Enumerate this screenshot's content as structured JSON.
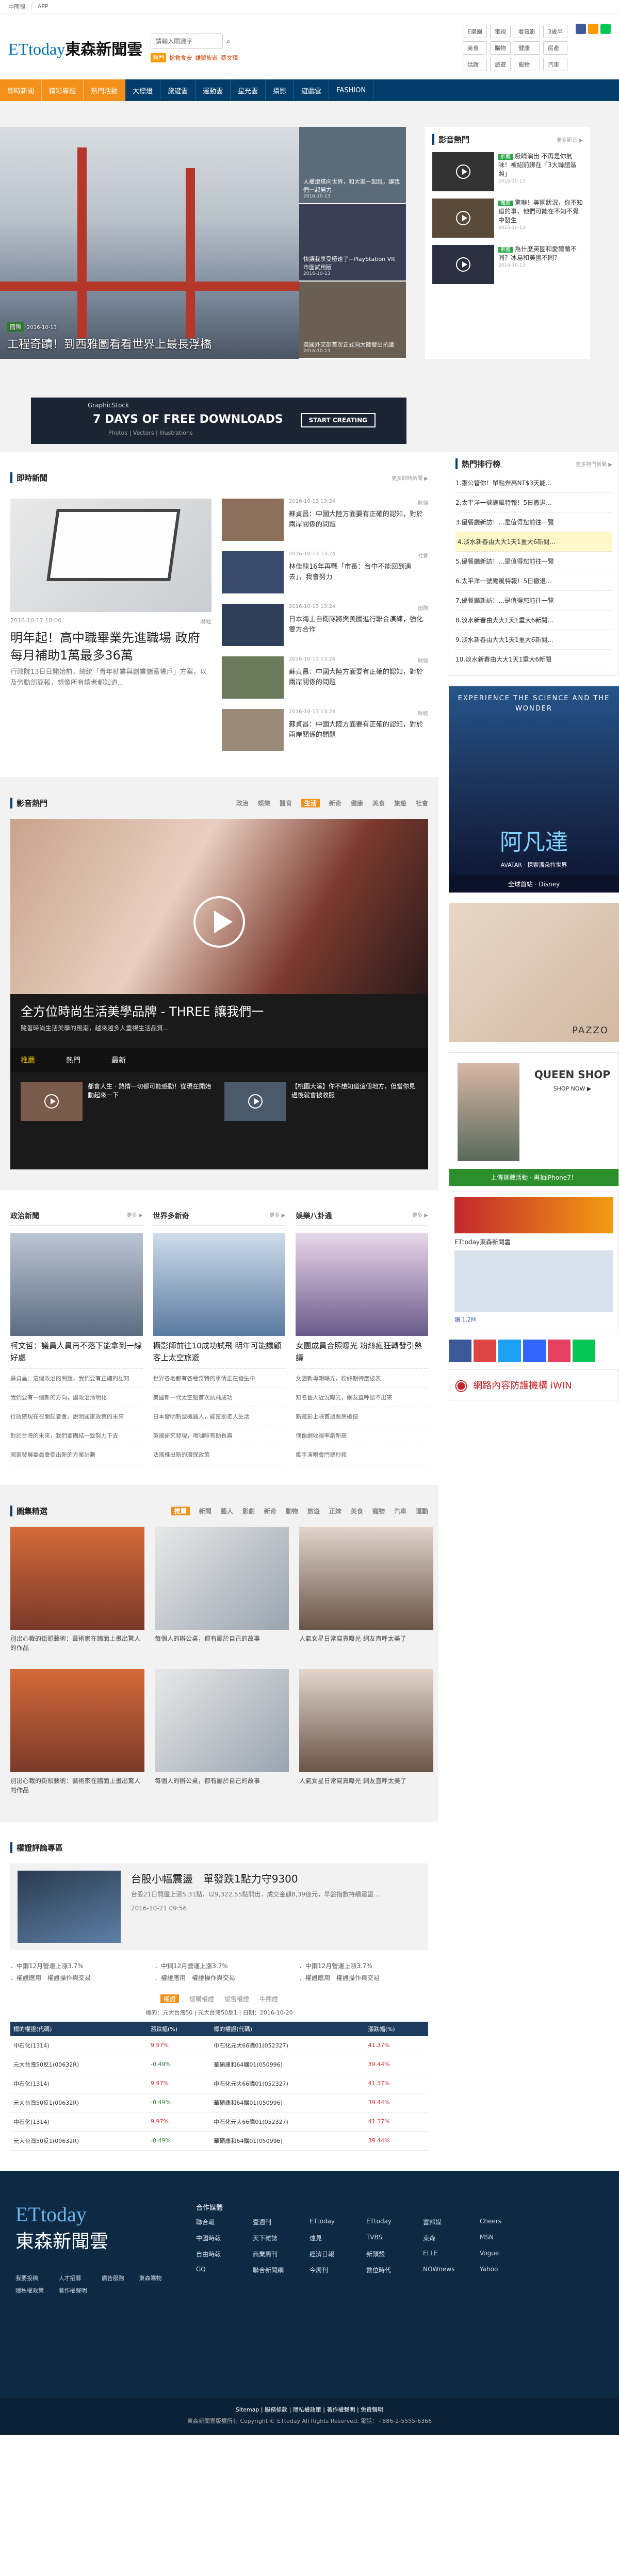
{
  "topbar": {
    "links": [
      "中國報",
      "APP"
    ]
  },
  "header": {
    "logo_en": "ETtoday",
    "logo_zh": "東森新聞雲",
    "search_placeholder": "請輸入關鍵字",
    "hot_label": "熱門",
    "hot_terms": [
      "搶救食安",
      "雄獅旅遊",
      "蔡文輝"
    ],
    "links": [
      "E樂園",
      "電視",
      "看電影",
      "3歲半",
      "美食",
      "購物",
      "健康",
      "房產",
      "話題",
      "旅遊",
      "寵物",
      "汽車"
    ]
  },
  "nav": {
    "orange": [
      "即時新聞",
      "精彩專題",
      "熱門活動"
    ],
    "items": [
      "大標燈",
      "旅遊雲",
      "運動雲",
      "星光雲",
      "攝影",
      "遊戲雲",
      "FASHION"
    ]
  },
  "hero": {
    "tag": "國際",
    "date": "2016-10-13",
    "title": "工程奇蹟！到西雅圖看看世界上最長浮橋",
    "side": [
      {
        "title": "人權燈塔向世界，和大家一起說，讓我們一起努力",
        "date": "2016-10-13"
      },
      {
        "title": "快讓我享受極速了~PlayStation VR 市面試用版",
        "date": "2016-10-13"
      },
      {
        "title": "英國外交部首次正式向大陸發出抗議",
        "date": "2016-10-13"
      }
    ]
  },
  "hot_video": {
    "title": "影音熱門",
    "more": "更多影音 ▶",
    "items": [
      {
        "tag": "推薦",
        "title": "吸睛演出 不再是你氣味！被紹前綁在「3大聯誼區照」",
        "date": "2016-10-13"
      },
      {
        "tag": "推薦",
        "title": "驚嚇！美國狀況，你不知道的事，他們可能在不知不覺中發生",
        "date": "2016-10-13"
      },
      {
        "tag": "推薦",
        "title": "為什麼英國和愛爾蘭不同？冰島和美國不同？",
        "date": "2016-10-13"
      }
    ]
  },
  "ad_banner": {
    "brand": "GraphicStock",
    "headline": "7 DAYS OF FREE DOWNLOADS",
    "sub": "Photos | Vectors | Illustrations",
    "cta": "START CREATING"
  },
  "instant": {
    "title": "即時新聞",
    "more": "更多即時新聞 ▶",
    "lead": {
      "date": "2016-10-17 18:00",
      "tag": "財經",
      "title": "明年起！高中職畢業先進職場 政府每月補助1萬最多36萬",
      "excerpt": "行政院13日日開始前，總統「青年就業與創業儲蓄帳戶」方案，以及勞動部簡報，想像所有讀者都知道..."
    },
    "items": [
      {
        "date": "2016-10-13 13:24",
        "tag": "財經",
        "title": "蘇貞昌：中國大陸方面要有正確的認知，對於兩岸關係的問題"
      },
      {
        "date": "2016-10-13 13:24",
        "tag": "社會",
        "title": "林佳龍16年再戰「市長：台中不能回到過去」，我會努力"
      },
      {
        "date": "2016-10-13 13:24",
        "tag": "國際",
        "title": "日本海上自衛隊將與美國進行聯合演練，強化雙方合作"
      },
      {
        "date": "2016-10-13 13:24",
        "tag": "財經",
        "title": "蘇貞昌：中國大陸方面要有正確的認知，對於兩岸關係的問題"
      },
      {
        "date": "2016-10-13 13:24",
        "tag": "財經",
        "title": "蘇貞昌：中國大陸方面要有正確的認知，對於兩岸關係的問題"
      }
    ]
  },
  "video_sec": {
    "title": "影音熱門",
    "tabs": [
      "政治",
      "娛樂",
      "體育",
      "生活",
      "新奇",
      "健康",
      "美食",
      "旅遊",
      "社會"
    ],
    "active_tab": "生活",
    "main_title": "全方位時尚生活美學品牌 - THREE 讓我們一",
    "main_sub": "隨著時尚生活美學的風潮，越來越多人重視生活品質...",
    "strip_tabs": [
      "推薦",
      "熱門",
      "最新"
    ],
    "thumbs": [
      {
        "title": "都會人生 · 熱情一切都可能感動！從現在開始動起來一下"
      },
      {
        "title": "【桃園大溪】你不想知道這個地方，但當你見過後就會被收服"
      }
    ]
  },
  "tri": [
    {
      "head": "政治新聞",
      "more": "更多 ▶",
      "title": "柯文哲：議員人員再不落下能拿到一線好處",
      "list": [
        "蘇貞昌：這個政治的問題，我們要有正確的認知",
        "我們要有一個新的方向，讓政治清明化",
        "行政院現在召開記者會，說明國家政策的未來",
        "對於台灣的未來，我們要團結一致努力下去",
        "國家發展委員會提出新的方案計劃"
      ]
    },
    {
      "head": "世界多新奇",
      "more": "更多 ▶",
      "title": "攝影師前往10成功試飛 明年可能讓顧客上太空旅遊",
      "list": [
        "世界各地都有各種奇特的事情正在發生中",
        "美國新一代太空船首次試飛成功",
        "日本發明新型機器人，能幫助老人生活",
        "英國研究發現，喝咖啡有助長壽",
        "法國推出新的環保政策"
      ]
    },
    {
      "head": "娛樂八卦通",
      "more": "更多 ▶",
      "title": "女團成員合照曝光 粉絲瘋狂轉發引熱議",
      "list": [
        "女團新專輯曝光，粉絲期待度破表",
        "知名藝人近況曝光，網友直呼認不出來",
        "新電影上映首週票房破億",
        "偶像劇收視率創新高",
        "歌手演唱會門票秒殺"
      ]
    }
  ],
  "gallery": {
    "title": "圖集精選",
    "tabs": [
      "推薦",
      "新聞",
      "藝人",
      "影劇",
      "新奇",
      "動物",
      "旅遊",
      "正妹",
      "美食",
      "寵物",
      "汽車",
      "運動"
    ],
    "active_tab": "推薦",
    "items": [
      {
        "caption": "別出心裁的街頭藝術：藝術家在牆面上畫出驚人的作品"
      },
      {
        "caption": "每個人的辦公桌，都有屬於自己的故事"
      },
      {
        "caption": "人氣女星日常寫真曝光 網友直呼太美了"
      },
      {
        "caption": "別出心裁的街頭藝術：藝術家在牆面上畫出驚人的作品"
      },
      {
        "caption": "每個人的辦公桌，都有屬於自己的故事"
      },
      {
        "caption": "人氣女星日常寫真曝光 網友直呼太美了"
      }
    ]
  },
  "finance": {
    "title": "權證評論專區",
    "lead_title": "台股小幅震盪　單發跌1點力守9300",
    "lead_body": "台股21日開盤上漲5.31點，以9,322.55點開出，成交金額8,39億元，早盤指數持續震盪...",
    "lead_date": "2016-10-21 09:56",
    "cols": [
      [
        "．中鋼12月營運上漲3.7%",
        "．權證應用　權證操作與交易"
      ],
      [
        "．中鋼12月營運上漲3.7%",
        "．權證應用　權證操作與交易"
      ],
      [
        "．中鋼12月營運上漲3.7%",
        "．權證應用　權證操作與交易"
      ]
    ],
    "tabs": [
      "權證",
      "認購權證",
      "認售權證",
      "牛熊證"
    ],
    "active_tab": "權證",
    "note": "標的：元大台灣50 | 元大台灣50反1 | 日期：2016-10-20",
    "table_head": [
      "標的權證(代碼)",
      "漲跌幅(%)",
      "標的權證(代碼)",
      "漲跌幅(%)"
    ],
    "rows": [
      [
        "中石化(1314)",
        "9.97%",
        "中石化元大66購01(052327)",
        "41.37%"
      ],
      [
        "元大台灣50反1(00632R)",
        "-0.49%",
        "華碩康和64購01(050996)",
        "39.44%"
      ],
      [
        "中石化(1314)",
        "9.97%",
        "中石化元大66購01(052327)",
        "41.37%"
      ],
      [
        "元大台灣50反1(00632R)",
        "-0.49%",
        "華碩康和64購01(050996)",
        "39.44%"
      ],
      [
        "中石化(1314)",
        "9.97%",
        "中石化元大66購01(052327)",
        "41.37%"
      ],
      [
        "元大台灣50反1(00632R)",
        "-0.49%",
        "華碩康和64購01(050996)",
        "39.44%"
      ]
    ]
  },
  "sidebar": {
    "rank_title": "熱門排行榜",
    "rank_more": "更多熱門新聞 ▶",
    "rank": [
      "1.張公管你！單點奔高NT$3天能...",
      "2.太平洋一號颱風特報！5日撤退...",
      "3.優餐廳新訪！...是值得您前往一覽",
      "4.淡水新春由大大1天1重大6新閱...",
      "5.優餐廳新訪！...是值得您前往一覽",
      "6.太平洋一號颱風特報！5日撤退...",
      "7.優餐廳新訪！...是值得您前往一覽",
      "8.淡水新春由大大1天1重大6新閱...",
      "9.淡水新春由大大1天1重大6新閱...",
      "10.淡水新春由大大1天1重大6新閱"
    ],
    "avatar_ad": {
      "h": "EXPERIENCE THE SCIENCE AND THE WONDER",
      "logo": "阿凡達",
      "sub": "AVATAR · 探索潘朵拉世界",
      "bot": "全球首站 · Disney"
    },
    "fashion_ad": {
      "brand": "PAZZO"
    },
    "queen_ad": {
      "title": "QUEEN SHOP",
      "cta": "SHOP NOW ▶",
      "bar": "上傳挑戰活動 · 再抽iPhone7！"
    },
    "fb": {
      "page": "ETtoday東森新聞雲",
      "likes": "讚 1.2M"
    },
    "win": {
      "text": "網路內容防護機構 iWIN"
    }
  },
  "footer": {
    "logo_en": "ETtoday",
    "logo_zh": "東森新聞雲",
    "coop": "合作媒體",
    "left_links": [
      "我要投稿",
      "人才招募",
      "廣告服務",
      "東森購物",
      "隱私權政策",
      "著作權聲明"
    ],
    "links": [
      "聯合報",
      "壹週刊",
      "ETtoday",
      "ETtoday",
      "富邦媒",
      "Cheers",
      "中國時報",
      "天下雜誌",
      "遠見",
      "TVBS",
      "東森",
      "MSN",
      "自由時報",
      "商業周刊",
      "經濟日報",
      "新頭殼",
      "ELLE",
      "Vogue",
      "GQ",
      "聯合新聞網",
      "今周刊",
      "數位時代",
      "NOWnews",
      "Yahoo"
    ],
    "copy1": "Sitemap | 服務條款 | 隱私權政策 | 著作權聲明 | 免責聲明",
    "copy2": "東森新聞雲版權所有 Copyright © ETtoday All Rights Reserved. 電話：+886-2-5555-6366"
  },
  "colors": {
    "navy": "#033e6b",
    "orange": "#f3901b"
  }
}
